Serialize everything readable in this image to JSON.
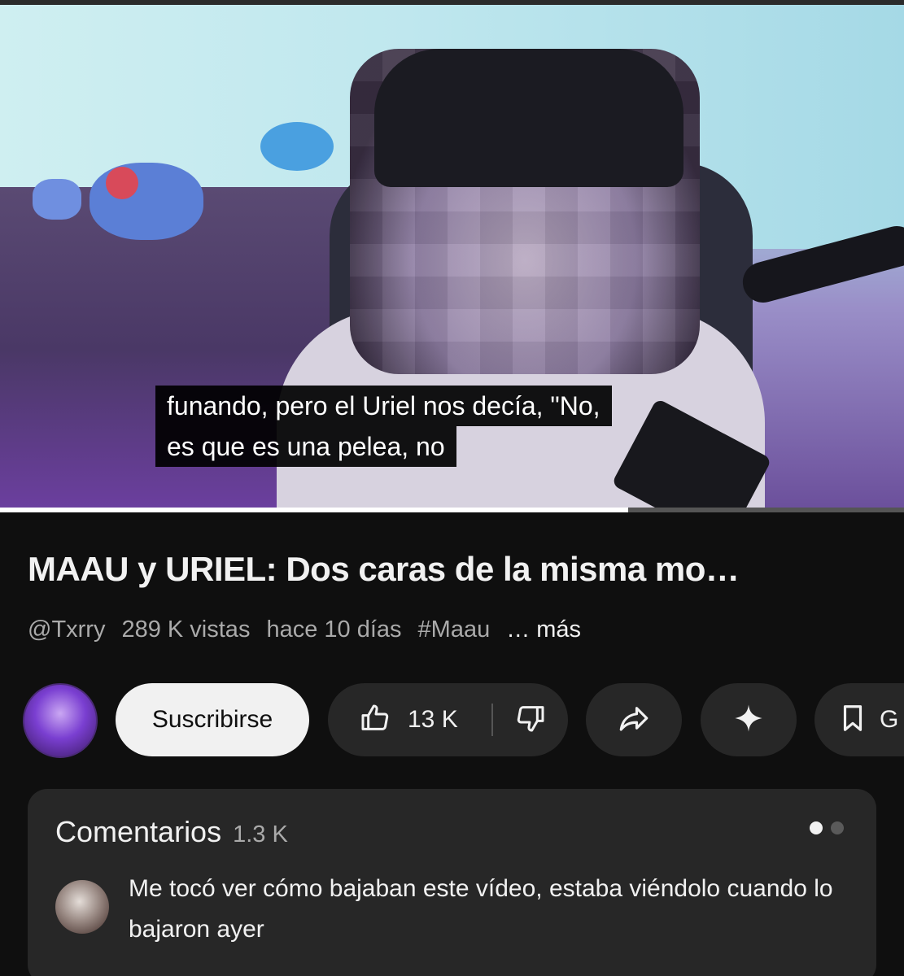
{
  "video": {
    "caption_line1": "funando, pero el Uriel nos decía, \"No,",
    "caption_line2": "es que es una pelea, no",
    "progress_fraction": 0.695
  },
  "info": {
    "title": "MAAU y URIEL: Dos caras de la misma mo…",
    "channel": "@Txrry",
    "views": "289 K vistas",
    "age": "hace 10 días",
    "hashtag": "#Maau",
    "more": "… más"
  },
  "actions": {
    "subscribe_label": "Suscribirse",
    "like_count": "13 K",
    "save_label": "G",
    "icons": [
      "thumbs-up-icon",
      "thumbs-down-icon",
      "share-icon",
      "sparkle-icon",
      "bookmark-icon"
    ]
  },
  "comments": {
    "title": "Comentarios",
    "count": "1.3 K",
    "first_comment": "Me tocó ver cómo bajaban este vídeo, estaba viéndolo cuando lo bajaron ayer"
  }
}
